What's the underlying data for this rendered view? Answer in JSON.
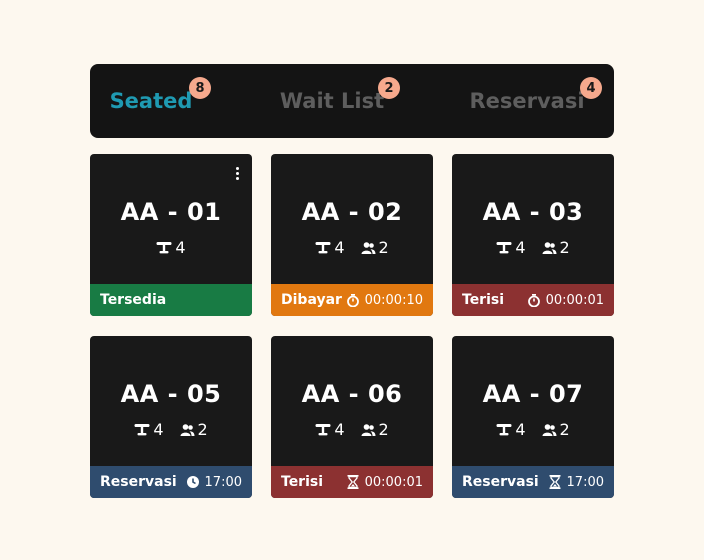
{
  "tabs": [
    {
      "label": "Seated",
      "count": "8",
      "active": true
    },
    {
      "label": "Wait List",
      "count": "2",
      "active": false
    },
    {
      "label": "Reservasi",
      "count": "4",
      "active": false
    }
  ],
  "status_colors": {
    "Tersedia": "#187b44",
    "Dibayar": "#e17810",
    "Terisi": "#8c3131",
    "Reservasi": "#2f4c6e"
  },
  "tables": [
    {
      "name": "AA - 01",
      "seats": "4",
      "guests": null,
      "status": "Tersedia",
      "icon": null,
      "time": null,
      "menu": true
    },
    {
      "name": "AA - 02",
      "seats": "4",
      "guests": "2",
      "status": "Dibayar",
      "icon": "stopwatch-icon",
      "time": "00:00:10"
    },
    {
      "name": "AA - 03",
      "seats": "4",
      "guests": "2",
      "status": "Terisi",
      "icon": "stopwatch-icon",
      "time": "00:00:01"
    },
    {
      "name": "AA - 05",
      "seats": "4",
      "guests": "2",
      "status": "Reservasi",
      "icon": "clock-icon",
      "time": "17:00"
    },
    {
      "name": "AA - 06",
      "seats": "4",
      "guests": "2",
      "status": "Terisi",
      "icon": "hourglass-icon",
      "time": "00:00:01"
    },
    {
      "name": "AA - 07",
      "seats": "4",
      "guests": "2",
      "status": "Reservasi",
      "icon": "hourglass-icon",
      "time": "17:00"
    }
  ]
}
